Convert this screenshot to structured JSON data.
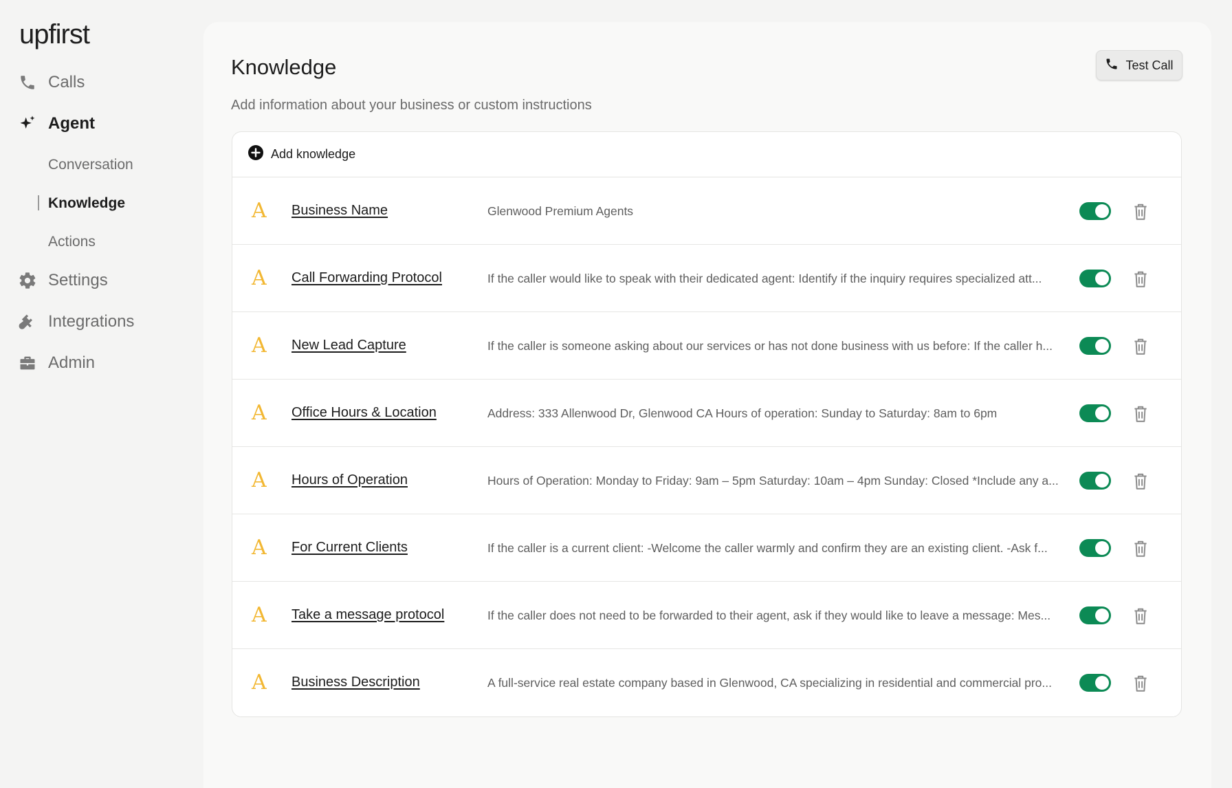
{
  "app": {
    "logo": "upfirst"
  },
  "sidebar": {
    "items": [
      {
        "label": "Calls",
        "icon": "phone-icon"
      },
      {
        "label": "Agent",
        "icon": "sparkle-icon"
      },
      {
        "label": "Settings",
        "icon": "gear-icon"
      },
      {
        "label": "Integrations",
        "icon": "plug-icon"
      },
      {
        "label": "Admin",
        "icon": "briefcase-icon"
      }
    ],
    "sub_items": [
      {
        "label": "Conversation"
      },
      {
        "label": "Knowledge"
      },
      {
        "label": "Actions"
      }
    ]
  },
  "page": {
    "title": "Knowledge",
    "subtitle": "Add information about your business or custom instructions",
    "test_call_label": "Test Call"
  },
  "knowledge": {
    "add_label": "Add knowledge",
    "type_glyph": "A",
    "items": [
      {
        "title": "Business Name",
        "description": "Glenwood Premium Agents",
        "enabled": true
      },
      {
        "title": "Call Forwarding Protocol",
        "description": "If the caller would like to speak with their dedicated agent: Identify if the inquiry requires specialized att...",
        "enabled": true
      },
      {
        "title": "New Lead Capture",
        "description": "If the caller is someone asking about our services or has not done business with us before: If the caller h...",
        "enabled": true
      },
      {
        "title": "Office Hours & Location",
        "description": "Address: 333 Allenwood Dr, Glenwood CA Hours of operation: Sunday to Saturday: 8am to 6pm",
        "enabled": true
      },
      {
        "title": "Hours of Operation",
        "description": "Hours of Operation: Monday to Friday: 9am – 5pm Saturday: 10am – 4pm Sunday: Closed *Include any a...",
        "enabled": true
      },
      {
        "title": "For Current Clients",
        "description": "If the caller is a current client: -Welcome the caller warmly and confirm they are an existing client. -Ask f...",
        "enabled": true
      },
      {
        "title": "Take a message protocol",
        "description": "If the caller does not need to be forwarded to their agent, ask if they would like to leave a message: Mes...",
        "enabled": true
      },
      {
        "title": "Business Description",
        "description": "A full-service real estate company based in Glenwood, CA specializing in residential and commercial pro...",
        "enabled": true
      }
    ]
  },
  "colors": {
    "accent": "#0c8a55",
    "type_icon": "#f2b732"
  }
}
